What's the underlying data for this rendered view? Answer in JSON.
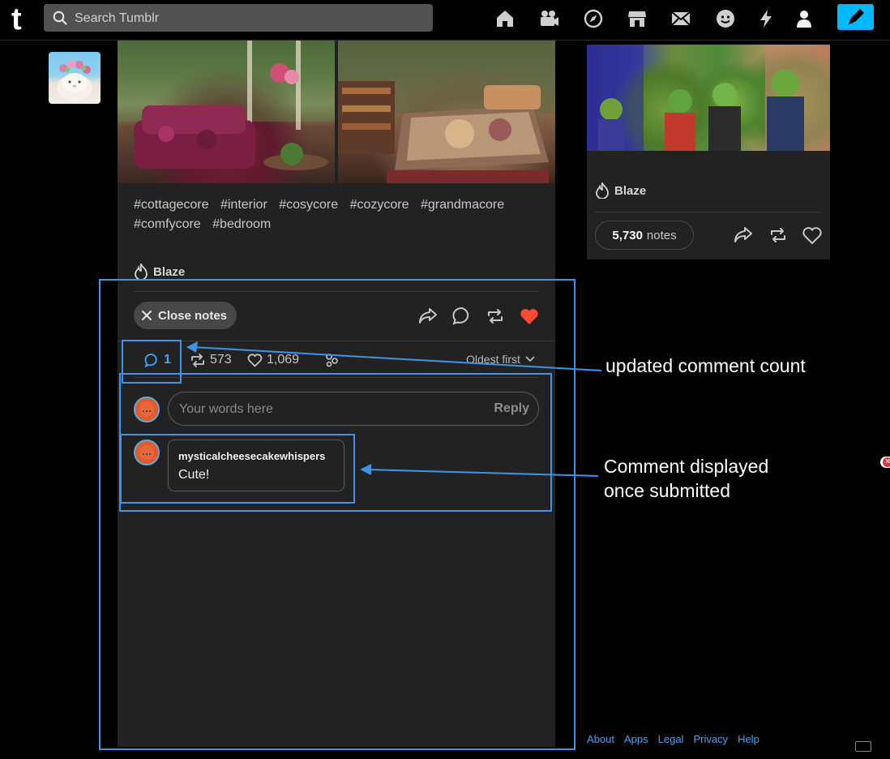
{
  "topbar": {
    "logo": "t",
    "search_placeholder": "Search Tumblr",
    "nav_icons": [
      "home-icon",
      "video-icon",
      "explore-icon",
      "shop-icon",
      "inbox-icon",
      "chat-icon",
      "activity-icon",
      "account-icon"
    ],
    "compose_icon": "pencil-icon"
  },
  "post": {
    "tags_line1": [
      "#cottagecore",
      "#interior",
      "#cosycore",
      "#cozycore",
      "#grandmacore"
    ],
    "tags_line2": [
      "#comfycore",
      "#bedroom"
    ],
    "blaze_label": "Blaze",
    "close_notes_label": "Close notes",
    "tabs": {
      "comments_count": "1",
      "reblogs_count": "573",
      "likes_count": "1,069"
    },
    "sort_label": "Oldest first",
    "reply_placeholder": "Your words here",
    "reply_button": "Reply",
    "comment": {
      "username": "mysticalcheesecakewhispers",
      "text": "Cute!"
    }
  },
  "sidebar": {
    "blaze_label": "Blaze",
    "notes_count": "5,730",
    "notes_word": "notes"
  },
  "footer": {
    "links": [
      "About",
      "Apps",
      "Legal",
      "Privacy",
      "Help"
    ]
  },
  "annotations": {
    "comment_count_label": "updated comment count",
    "comment_displayed_line1": "Comment displayed",
    "comment_displayed_line2": "once submitted"
  },
  "colors": {
    "accent_blue": "#3ea7ff",
    "annotation_blue": "#3c95e8",
    "like_red": "#ff4930",
    "compose_blue": "#00b8ff"
  }
}
